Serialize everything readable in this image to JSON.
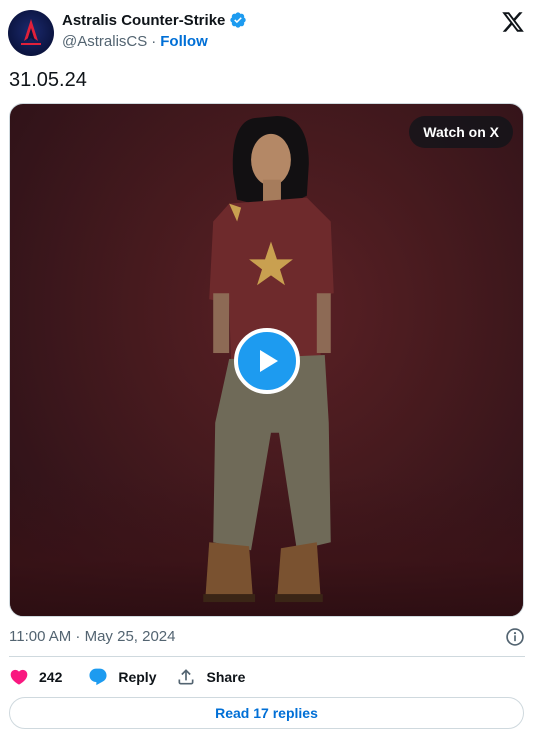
{
  "account": {
    "display_name": "Astralis Counter-Strike",
    "handle": "@AstralisCS",
    "separator": "·",
    "follow_label": "Follow",
    "verified": true
  },
  "tweet": {
    "text": "31.05.24",
    "timestamp": "11:00 AM · May 25, 2024"
  },
  "media": {
    "watch_label": "Watch on X",
    "play_icon": "play-icon"
  },
  "actions": {
    "likes_count": "242",
    "reply_label": "Reply",
    "share_label": "Share"
  },
  "read_replies_label": "Read 17 replies",
  "colors": {
    "accent": "#1d9bf0",
    "link": "#006fd6",
    "like": "#f91880",
    "muted": "#536471",
    "border": "#cfd9de"
  }
}
